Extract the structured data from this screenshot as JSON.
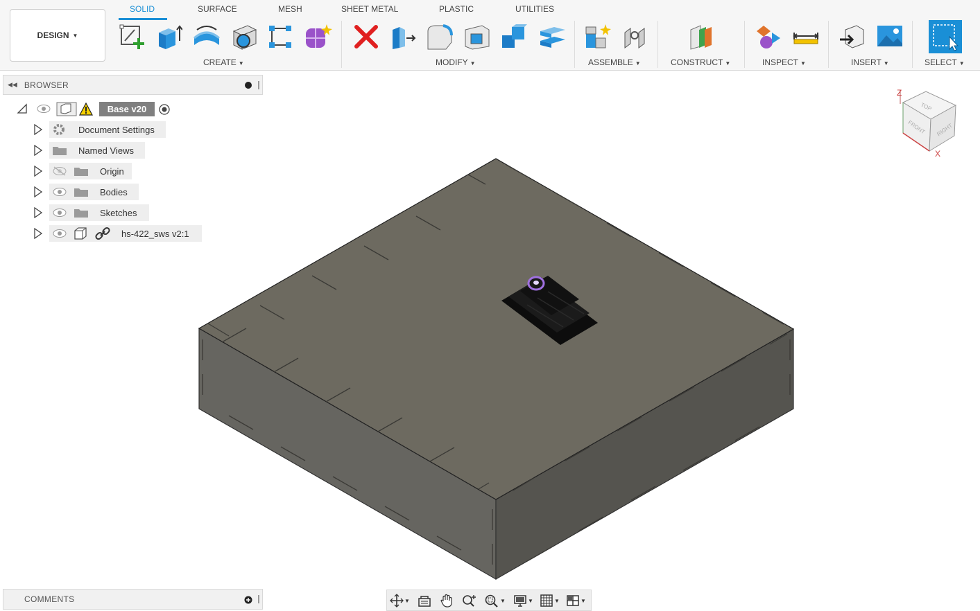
{
  "toolbar": {
    "workspace_button": "DESIGN",
    "tabs": [
      {
        "label": "SOLID",
        "active": true
      },
      {
        "label": "SURFACE",
        "active": false
      },
      {
        "label": "MESH",
        "active": false
      },
      {
        "label": "SHEET METAL",
        "active": false
      },
      {
        "label": "PLASTIC",
        "active": false
      },
      {
        "label": "UTILITIES",
        "active": false
      }
    ],
    "groups": {
      "create": "CREATE",
      "modify": "MODIFY",
      "assemble": "ASSEMBLE",
      "construct": "CONSTRUCT",
      "inspect": "INSPECT",
      "insert": "INSERT",
      "select": "SELECT"
    },
    "accent_color": "#1a8fd6"
  },
  "browser": {
    "title": "BROWSER",
    "root": {
      "label": "Base v20",
      "warning": true
    },
    "items": [
      {
        "label": "Document Settings",
        "icon": "gear-icon"
      },
      {
        "label": "Named Views",
        "icon": "folder-icon"
      },
      {
        "label": "Origin",
        "icon": "folder-icon",
        "visibility": "hidden-eye-icon"
      },
      {
        "label": "Bodies",
        "icon": "folder-icon",
        "visibility": "eye-icon"
      },
      {
        "label": "Sketches",
        "icon": "folder-icon",
        "visibility": "eye-icon"
      },
      {
        "label": "hs-422_sws v2:1",
        "icon": "component-icon",
        "visibility": "eye-icon",
        "linked": true
      }
    ]
  },
  "comments": {
    "title": "COMMENTS"
  },
  "viewcube": {
    "faces": [
      "TOP",
      "FRONT",
      "RIGHT"
    ],
    "axes": [
      "Z",
      "X"
    ]
  },
  "scene": {
    "model": "laser-cut box with servo",
    "box_color": "#5f5d56"
  }
}
